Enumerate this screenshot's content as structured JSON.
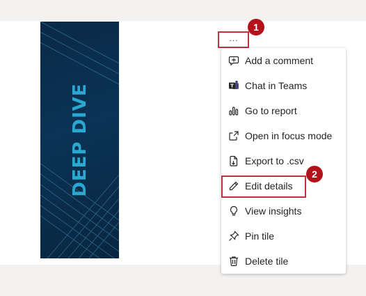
{
  "tile": {
    "text": "DEEP DIVE"
  },
  "more_button": {
    "label": "···"
  },
  "callouts": [
    "1",
    "2"
  ],
  "menu": {
    "items": [
      {
        "label": "Add a comment",
        "icon": "comment-icon"
      },
      {
        "label": "Chat in Teams",
        "icon": "teams-icon"
      },
      {
        "label": "Go to report",
        "icon": "report-chart-icon"
      },
      {
        "label": "Open in focus mode",
        "icon": "focus-mode-icon"
      },
      {
        "label": "Export to .csv",
        "icon": "export-icon"
      },
      {
        "label": "Edit details",
        "icon": "pencil-icon"
      },
      {
        "label": "View insights",
        "icon": "lightbulb-icon"
      },
      {
        "label": "Pin tile",
        "icon": "pin-icon"
      },
      {
        "label": "Delete tile",
        "icon": "trash-icon"
      }
    ]
  },
  "colors": {
    "callout": "#b3121b",
    "highlight_border": "#c0333b",
    "tile_bg": "#0b3355",
    "tile_text": "#2aa8d0"
  }
}
